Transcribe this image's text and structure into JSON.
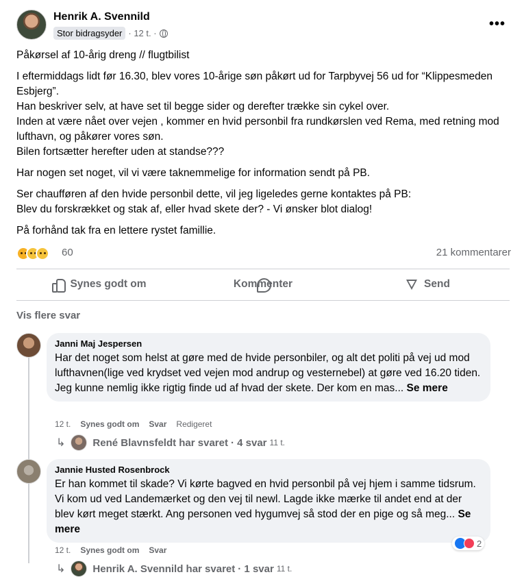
{
  "post": {
    "author": "Henrik A. Svennild",
    "badge": "Stor bidragsyder",
    "time": "· 12 t. ·",
    "paragraphs": [
      "Påkørsel af 10-årig dreng // flugtbilist",
      "I eftermiddags lidt før 16.30, blev vores 10-årige søn påkørt ud for Tarpbyvej 56 ud for “Klippesmeden Esbjerg”.\nHan beskriver selv, at have set til begge sider og derefter trække sin cykel over.\nInden at være nået over vejen , kommer en hvid personbil fra rundkørslen ved Rema, med retning mod lufthavn, og påkører vores søn.\nBilen fortsætter herefter uden at standse???",
      "Har nogen set noget, vil vi være taknemmelige for information sendt på PB.",
      "Ser chaufføren af den hvide personbil dette, vil jeg ligeledes gerne kontaktes på PB:\nBlev du forskrækket og stak af, eller hvad skete der? - Vi ønsker blot dialog!",
      "På forhånd tak fra en lettere rystet famillie."
    ],
    "reaction_count": "60",
    "comment_count": "21 kommentarer"
  },
  "actions": {
    "like": "Synes godt om",
    "comment": "Kommenter",
    "send": "Send"
  },
  "more_replies": "Vis flere svar",
  "comments": [
    {
      "author": "Janni Maj Jespersen",
      "text": "Har det noget som helst at gøre med de hvide personbiler, og alt det politi på vej ud mod lufthavnen(lige ved krydset ved vejen mod andrup og vesternebel) at gøre ved 16.20 tiden.\nJeg kunne nemlig ikke rigtig finde ud af hvad der skete. Der kom en mas...",
      "see_more": "Se mere",
      "time": "12 t.",
      "like": "Synes godt om",
      "reply": "Svar",
      "edited": "Redigeret",
      "replies_link": {
        "name": "René Blavnsfeldt har svaret",
        "count": "· 4 svar",
        "time": "11 t."
      }
    },
    {
      "author": "Jannie Husted Rosenbrock",
      "text": "Er han kommet til skade? Vi kørte bagved en hvid personbil på vej hjem i samme tidsrum. Vi kom ud ved Landemærket og den vej til newl. Lagde ikke mærke til andet end at der blev kørt meget stærkt. Ang personen ved hygumvej så stod der en pige og så meg...",
      "see_more": "Se mere",
      "time": "12 t.",
      "like": "Synes godt om",
      "reply": "Svar",
      "reaction_count": "2",
      "replies_link": {
        "name": "Henrik A. Svennild har svaret",
        "count": "· 1 svar",
        "time": "11 t."
      }
    }
  ]
}
